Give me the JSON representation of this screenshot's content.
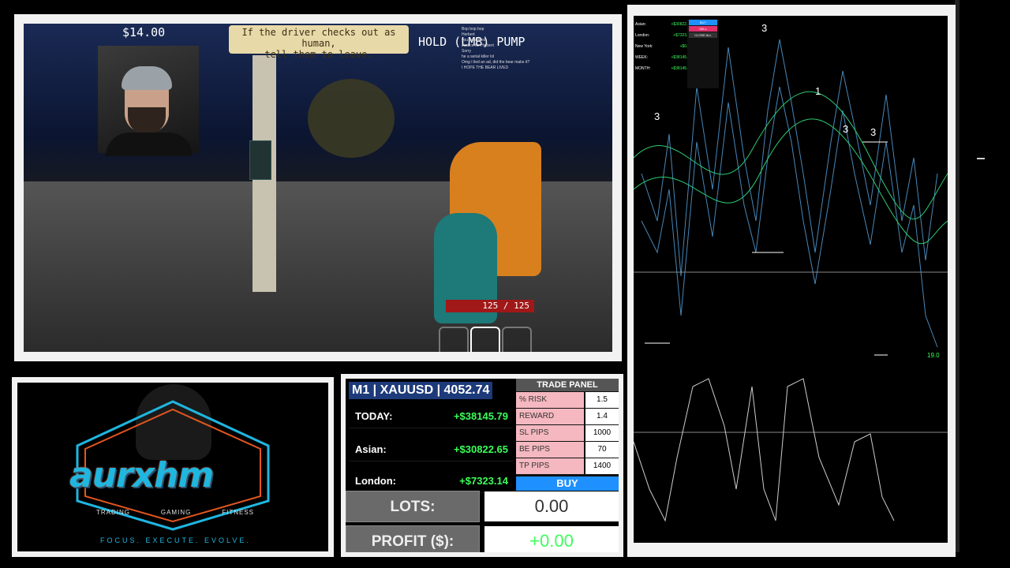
{
  "game": {
    "money": "$14.00",
    "quest_line1": "If the driver checks out as human,",
    "quest_line2": "tell them to leave.",
    "hint": "HOLD (LMB) PUMP",
    "health": "125 / 125",
    "chat": [
      "Bop bop bop",
      "Herbert",
      "you beat fired",
      "Justice for Herbert",
      "Sorry",
      "he a serial killer lol",
      "Omg I lied an ad, did the bear make it?",
      "I HOPE THE BEAR LIVED"
    ]
  },
  "logo": {
    "brand": "aurxhm",
    "categories": [
      "TRADING",
      "GAMING",
      "FITNESS"
    ],
    "tagline": "FOCUS. EXECUTE. EVOLVE."
  },
  "dashboard": {
    "title": "M1 | XAUUSD | 4052.74",
    "rows": [
      {
        "label": "TODAY:",
        "value": "+$38145.79"
      },
      {
        "label": "Asian:",
        "value": "+$30822.65"
      },
      {
        "label": "London:",
        "value": "+$7323.14"
      }
    ],
    "trade_panel": {
      "title": "TRADE PANEL",
      "fields": [
        {
          "label": "% RISK",
          "value": "1.5"
        },
        {
          "label": "REWARD",
          "value": "1.4"
        },
        {
          "label": "SL PIPS",
          "value": "1000"
        },
        {
          "label": "BE PIPS",
          "value": "70"
        },
        {
          "label": "TP PIPS",
          "value": "1400"
        }
      ],
      "buy_label": "BUY"
    },
    "lots_label": "LOTS:",
    "lots_value": "0.00",
    "profit_label": "PROFIT ($):",
    "profit_value": "+0.00"
  },
  "chart": {
    "accounts": [
      {
        "label": "Asian:",
        "value": "+$30822.65"
      },
      {
        "label": "London:",
        "value": "+$7323.14"
      },
      {
        "label": "New York:",
        "value": "+$0.00"
      },
      {
        "label": "WEEK:",
        "value": "+$38145.79"
      },
      {
        "label": "MONTH:",
        "value": "+$38145.79"
      }
    ],
    "mini_panel": [
      "BUY",
      "SELL",
      "CLOSE ALL"
    ],
    "labels": [
      "3",
      "1",
      "3",
      "3",
      "3"
    ],
    "price_tag": "19.0"
  },
  "colors": {
    "profit": "#3cff5a",
    "buy": "#1e90ff",
    "title_bar": "#1d3a7a"
  }
}
